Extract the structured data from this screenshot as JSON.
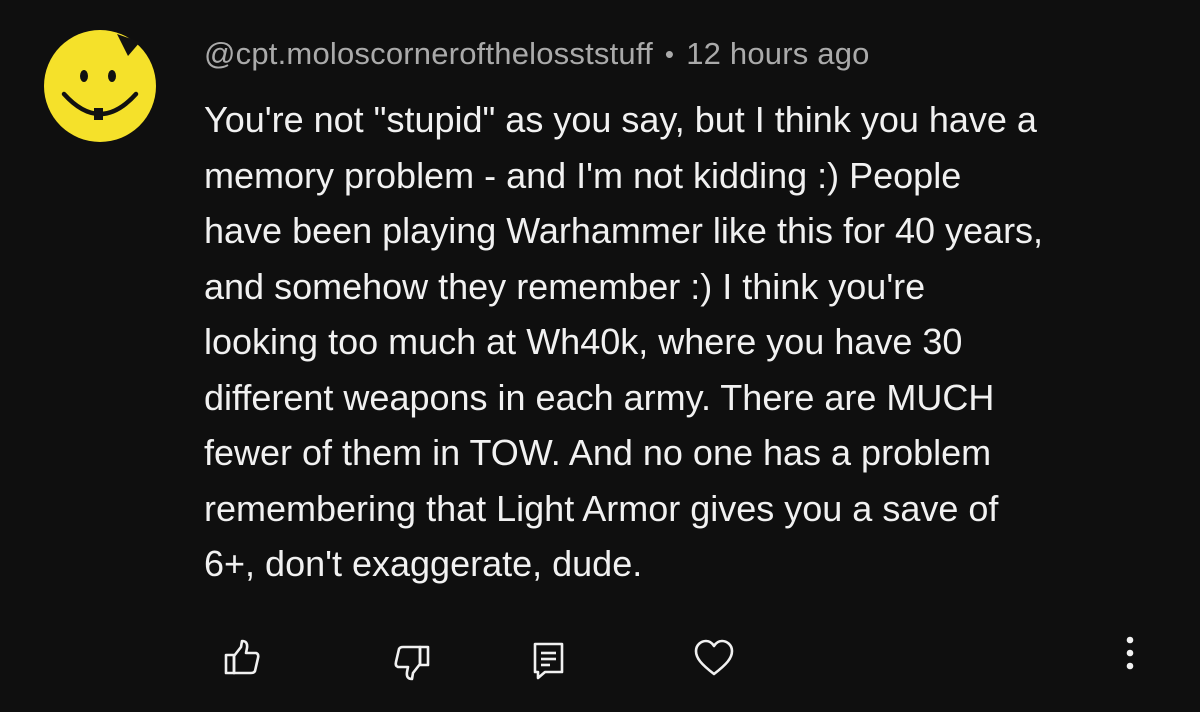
{
  "comment": {
    "author": "@cpt.moloscornerofthelosststuff",
    "separator": "•",
    "timestamp": "12 hours ago",
    "avatar_icon": "smiley-face-icon",
    "avatar_color": "#f5e12a",
    "body_lines": [
      "You're not \"stupid\" as you say, but I think you have a",
      "memory problem - and I'm not kidding :) People",
      "have been playing Warhammer like this for 40 years,",
      "and somehow they remember :) I think you're",
      "looking too much at Wh40k, where you have 30",
      "different weapons in each army. There are MUCH",
      "fewer of them in TOW. And no one has a problem",
      "remembering that Light Armor gives you a save of",
      "6+, don't exaggerate, dude."
    ]
  },
  "actions": {
    "icons": [
      "like-icon",
      "dislike-icon",
      "reply-icon",
      "heart-icon",
      "more-vertical-icon"
    ],
    "icon_color": "#f1f1f1"
  },
  "theme": {
    "background": "#0f0f0f",
    "text": "#f1f1f1",
    "secondary_text": "#aaaaaa"
  }
}
